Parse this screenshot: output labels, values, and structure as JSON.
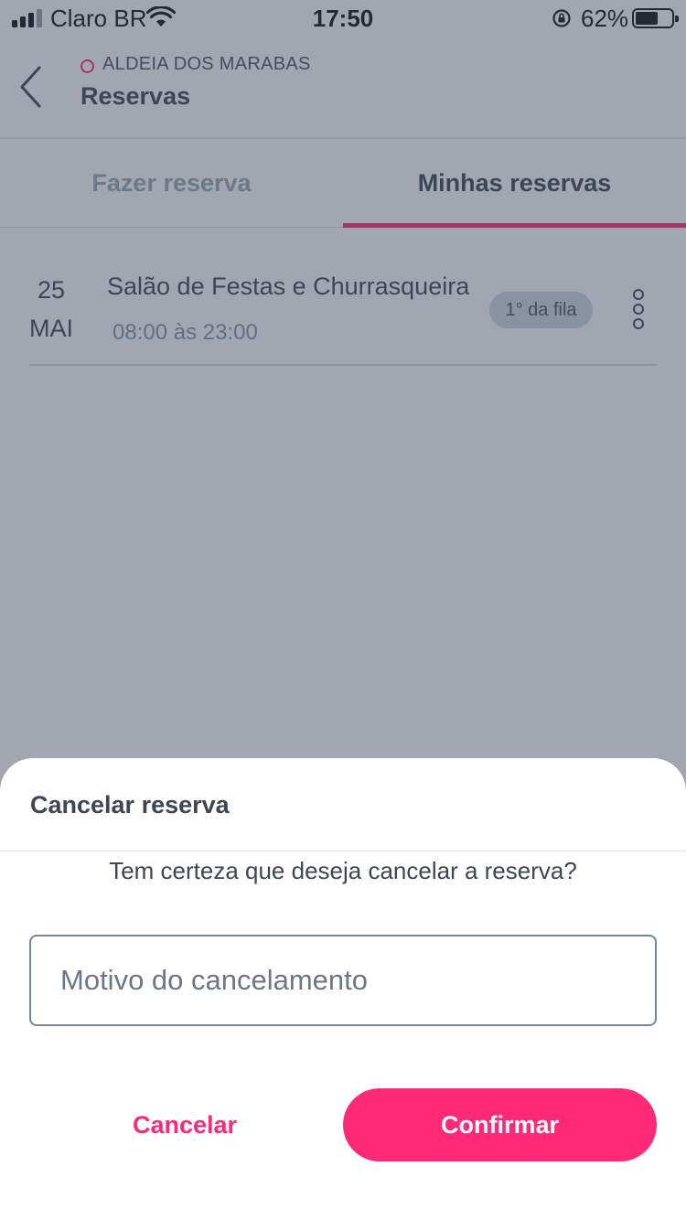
{
  "status_bar": {
    "carrier": "Claro BR",
    "time": "17:50",
    "battery_percent": "62%",
    "battery_level": 0.62,
    "signal_bars": 3,
    "icons": [
      "signal-icon",
      "wifi-icon",
      "rotation-lock-icon",
      "battery-icon"
    ]
  },
  "header": {
    "condominium": "ALDEIA DOS MARABAS",
    "title": "Reservas",
    "back_icon": "chevron-left-icon"
  },
  "tabs": [
    {
      "label": "Fazer reserva",
      "active": false
    },
    {
      "label": "Minhas reservas",
      "active": true
    }
  ],
  "reservations": [
    {
      "day": "25",
      "month": "MAI",
      "title": "Salão de Festas e Churrasqueira",
      "time": "08:00 às 23:00",
      "badge": "1° da fila",
      "menu_icon": "more-vertical-icon"
    }
  ],
  "dialog": {
    "title": "Cancelar reserva",
    "message": "Tem certeza que deseja cancelar a reserva?",
    "reason_placeholder": "Motivo do cancelamento",
    "reason_value": "",
    "cancel_label": "Cancelar",
    "confirm_label": "Confirmar"
  },
  "colors": {
    "accent": "#ff2a76",
    "text": "#3d4754",
    "muted": "#9aa7b8",
    "badge_bg": "#d1d8e1",
    "overlay": "rgba(58, 70, 90, 0.48)"
  }
}
